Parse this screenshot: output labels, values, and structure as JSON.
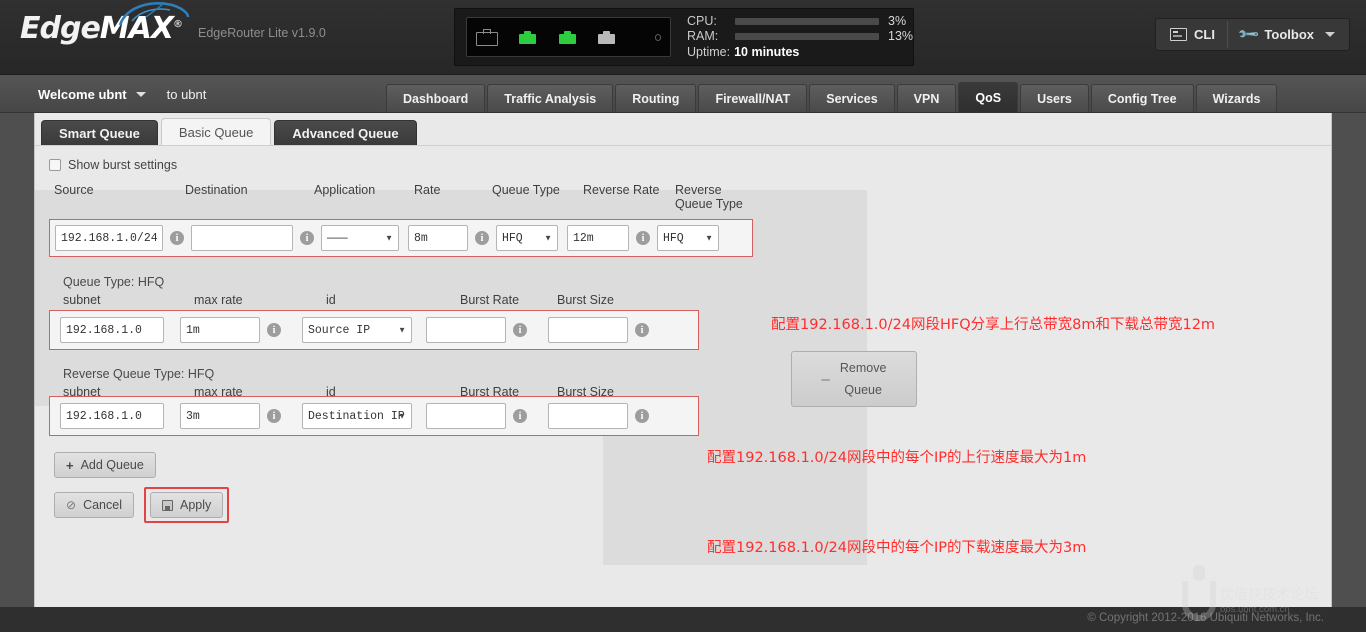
{
  "header": {
    "brand": "EdgeMAX",
    "brand_part1": "Edge",
    "brand_part2": "MAX",
    "registered_mark": "®",
    "model": "EdgeRouter Lite v1.9.0",
    "cpu_label": "CPU:",
    "cpu_value": "3%",
    "cpu_percent": 3,
    "ram_label": "RAM:",
    "ram_value": "13%",
    "ram_percent": 13,
    "uptime_label": "Uptime:",
    "uptime_value": "10 minutes",
    "cli_label": "CLI",
    "toolbox_label": "Toolbox",
    "accent_color": "#1b9fd8",
    "led_on_color": "#2ecc40",
    "led_off_color": "#b9b9b9",
    "ports": [
      {
        "name": "eth0",
        "state": "on"
      },
      {
        "name": "eth1",
        "state": "on"
      },
      {
        "name": "eth2",
        "state": "off"
      }
    ]
  },
  "nav": {
    "welcome": "Welcome ubnt",
    "host": "to ubnt",
    "tabs": [
      {
        "label": "Dashboard",
        "active": false
      },
      {
        "label": "Traffic Analysis",
        "active": false
      },
      {
        "label": "Routing",
        "active": false
      },
      {
        "label": "Firewall/NAT",
        "active": false
      },
      {
        "label": "Services",
        "active": false
      },
      {
        "label": "VPN",
        "active": false
      },
      {
        "label": "QoS",
        "active": true
      },
      {
        "label": "Users",
        "active": false
      },
      {
        "label": "Config Tree",
        "active": false
      },
      {
        "label": "Wizards",
        "active": false
      }
    ]
  },
  "subtabs": [
    {
      "label": "Smart Queue",
      "active": false
    },
    {
      "label": "Basic Queue",
      "active": true
    },
    {
      "label": "Advanced Queue",
      "active": false
    }
  ],
  "form": {
    "burst_checkbox_label": "Show burst settings",
    "burst_checked": false,
    "columns": {
      "source": "Source",
      "destination": "Destination",
      "application": "Application",
      "rate": "Rate",
      "queue_type": "Queue Type",
      "reverse_rate": "Reverse Rate",
      "reverse_queue_type": "Reverse Queue Type"
    },
    "queue_row": {
      "source_value": "192.168.1.0/24",
      "destination_value": "",
      "destination_placeholder": "",
      "application_value": "———",
      "rate_value": "8m",
      "queue_type_value": "HFQ",
      "reverse_rate_value": "12m",
      "reverse_queue_type_value": "HFQ"
    },
    "remove_button": {
      "line1": "Remove",
      "line2": "Queue",
      "icon": "minus-icon"
    },
    "queue_section": {
      "title": "Queue Type: HFQ",
      "labels": {
        "subnet": "subnet",
        "max_rate": "max rate",
        "id": "id",
        "burst_rate": "Burst Rate",
        "burst_size": "Burst Size"
      },
      "values": {
        "subnet": "192.168.1.0",
        "max_rate": "1m",
        "id": "Source IP",
        "burst_rate": "",
        "burst_size": ""
      }
    },
    "reverse_queue_section": {
      "title": "Reverse Queue Type: HFQ",
      "labels": {
        "subnet": "subnet",
        "max_rate": "max rate",
        "id": "id",
        "burst_rate": "Burst Rate",
        "burst_size": "Burst Size"
      },
      "values": {
        "subnet": "192.168.1.0",
        "max_rate": "3m",
        "id": "Destination IP",
        "burst_rate": "",
        "burst_size": ""
      }
    },
    "buttons": {
      "add_queue": "Add Queue",
      "cancel": "Cancel",
      "apply": "Apply"
    }
  },
  "annotations": {
    "color": "#ff2d2d",
    "items": [
      "配置192.168.1.0/24网段HFQ分享上行总带宽8m和下载总带宽12m",
      "配置192.168.1.0/24网段中的每个IP的上行速度最大为1m",
      "配置192.168.1.0/24网段中的每个IP的下载速度最大为3m"
    ]
  },
  "footer": {
    "copyright": "© Copyright 2012-2016 Ubiquiti Networks, Inc.",
    "watermark_title": "优倍快技术论坛",
    "watermark_url": "bbs.ubnt.com.cn"
  }
}
